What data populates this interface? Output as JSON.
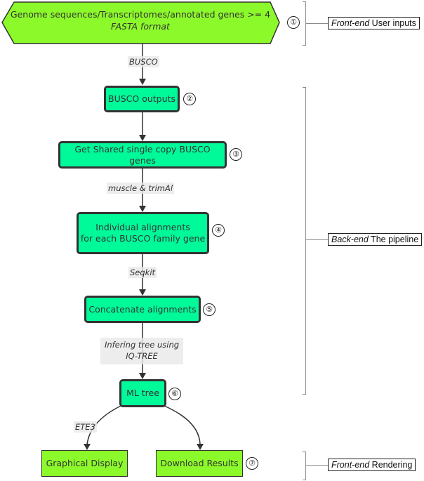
{
  "diagram": {
    "input_node": {
      "line1": "Genome sequences/Transcriptomes/annotated genes >= 4",
      "line2": "FASTA format",
      "step": "①",
      "fill": "#8cfa2a"
    },
    "nodes": [
      {
        "id": "busco-outputs",
        "label": "BUSCO outputs",
        "step": "②"
      },
      {
        "id": "shared-genes",
        "label": "Get Shared single copy BUSCO genes",
        "step": "③"
      },
      {
        "id": "individual-alignments",
        "line1": "Individual alignments",
        "line2": "for each BUSCO family gene",
        "step": "④"
      },
      {
        "id": "concatenate",
        "label": "Concatenate alignments",
        "step": "⑤"
      },
      {
        "id": "ml-tree",
        "label": "ML tree",
        "step": "⑥"
      }
    ],
    "output_nodes": [
      {
        "id": "graphical-display",
        "label": "Graphical Display"
      },
      {
        "id": "download-results",
        "label": "Download Results",
        "step": "⑦"
      }
    ],
    "edge_labels": {
      "busco": "BUSCO",
      "muscle": "muscle & trimAl",
      "seqkit": "Seqkit",
      "iqtree_line1": "Infering tree using",
      "iqtree_line2": "IQ-TREE",
      "ete3": "ETE3"
    },
    "colors": {
      "process_fill": "#00fa9a",
      "output_fill": "#8cfa2a",
      "stroke": "#333333",
      "bracket": "#8c8c8c"
    }
  },
  "sections": [
    {
      "id": "user-inputs",
      "emphasis": "Front-end",
      "text": " User inputs"
    },
    {
      "id": "pipeline",
      "emphasis": "Back-end",
      "text": " The pipeline"
    },
    {
      "id": "rendering",
      "emphasis": "Front-end",
      "text": " Rendering"
    }
  ]
}
